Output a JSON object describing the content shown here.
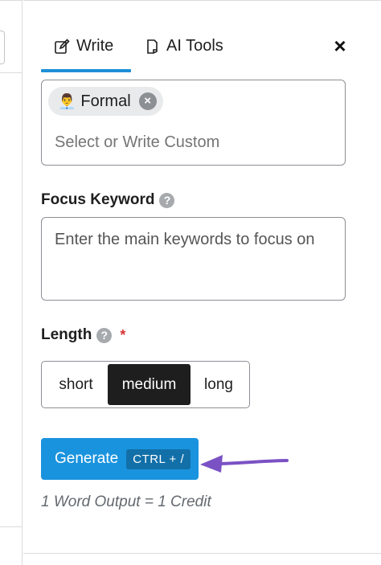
{
  "tabs": [
    {
      "label": "Write",
      "icon": "edit-icon",
      "active": true
    },
    {
      "label": "AI Tools",
      "icon": "ai-tools-icon",
      "active": false
    }
  ],
  "close_label": "×",
  "tone": {
    "chip_emoji": "👨‍💼",
    "chip_label": "Formal",
    "remove_label": "×",
    "placeholder": "Select or Write Custom"
  },
  "focus_keyword": {
    "label": "Focus Keyword",
    "help": "?",
    "placeholder": "Enter the main keywords to focus on"
  },
  "length": {
    "label": "Length",
    "help": "?",
    "required_mark": "*",
    "options": [
      "short",
      "medium",
      "long"
    ],
    "selected": "medium"
  },
  "generate": {
    "label": "Generate",
    "shortcut": "CTRL + /"
  },
  "credit_note": "1 Word Output = 1 Credit",
  "colors": {
    "accent": "#1a93de",
    "tab_underline": "#1e8fd6",
    "arrow": "#7b52c4",
    "required": "#d63638"
  }
}
